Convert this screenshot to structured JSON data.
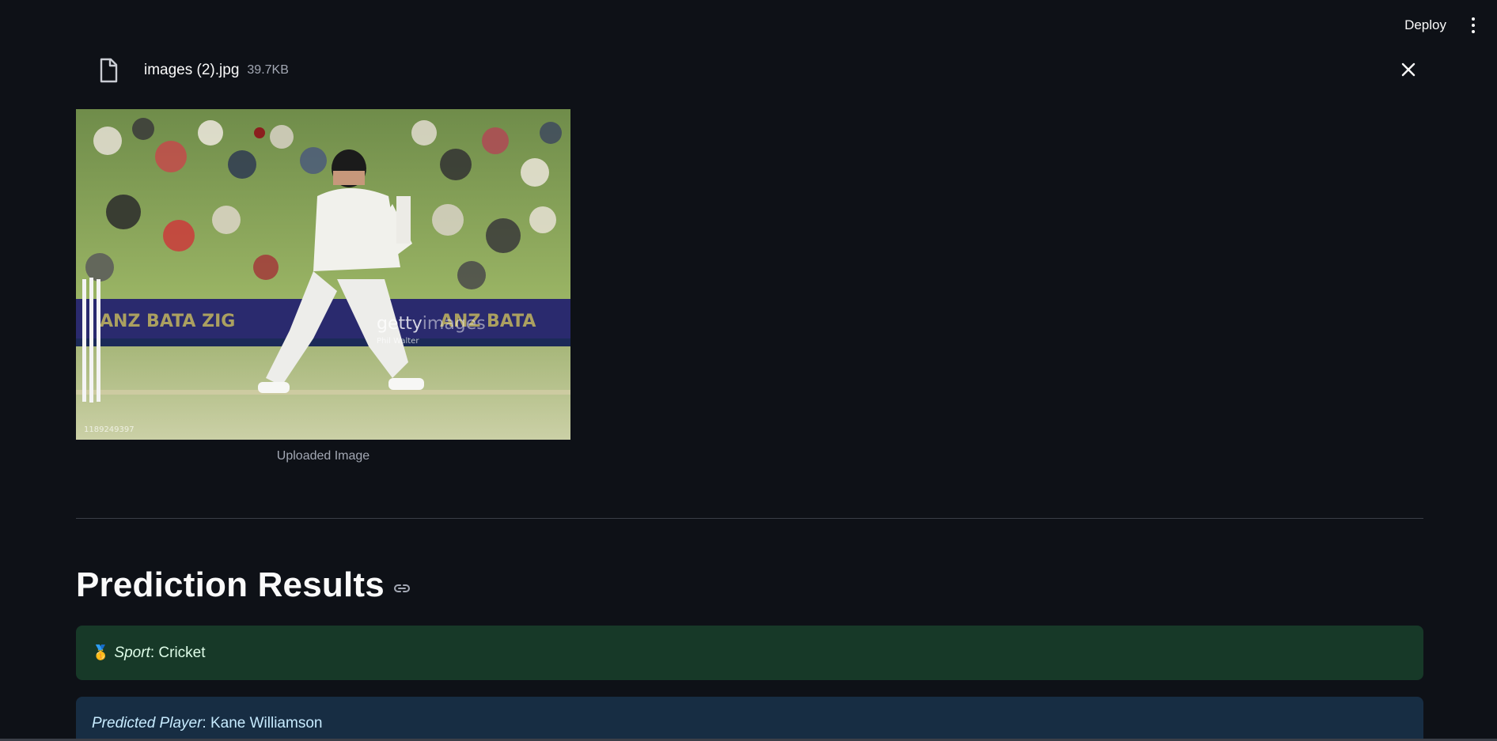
{
  "toolbar": {
    "deploy_label": "Deploy",
    "menu_icon": "kebab-menu-icon"
  },
  "file": {
    "icon": "file-icon",
    "name": "images (2).jpg",
    "size": "39.7KB",
    "close_icon": "close-icon"
  },
  "image": {
    "caption": "Uploaded Image",
    "watermark": "gettyimages",
    "watermark_credit": "Phil Walter",
    "image_id": "1189249397"
  },
  "results": {
    "heading": "Prediction Results",
    "link_icon": "link-icon",
    "sport_emoji": "🥇",
    "sport_label": "Sport",
    "sport_value": ": Cricket",
    "player_label": "Predicted Player",
    "player_value": ": Kane Williamson"
  },
  "colors": {
    "background": "#0e1117",
    "success_bg": "#173928",
    "info_bg": "#172d43"
  }
}
